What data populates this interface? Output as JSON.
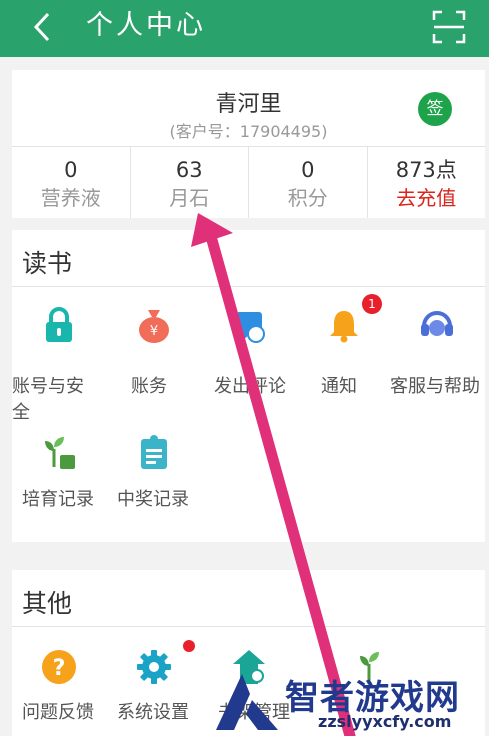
{
  "header": {
    "title": "个人中心",
    "back_icon": "chevron-left-icon",
    "scan_icon": "scan-icon"
  },
  "profile": {
    "name": "青河里",
    "customer_id": "(客户号：17904495)",
    "sign_label": "签",
    "stats": [
      {
        "value": "0",
        "label": "营养液"
      },
      {
        "value": "63",
        "label": "月石"
      },
      {
        "value": "0",
        "label": "积分"
      },
      {
        "value": "873点",
        "label": "去充值"
      }
    ]
  },
  "reading": {
    "title": "读书",
    "items": [
      {
        "label": "账号与安全",
        "icon": "lock-icon"
      },
      {
        "label": "账务",
        "icon": "money-bag-icon"
      },
      {
        "label": "发出评论",
        "icon": "comment-icon"
      },
      {
        "label": "通知",
        "icon": "bell-icon",
        "badge": "1"
      },
      {
        "label": "客服与帮助",
        "icon": "headset-icon"
      },
      {
        "label": "培育记录",
        "icon": "sprout-icon"
      },
      {
        "label": "中奖记录",
        "icon": "clipboard-icon"
      }
    ]
  },
  "other": {
    "title": "其他",
    "items": [
      {
        "label": "问题反馈",
        "icon": "question-icon"
      },
      {
        "label": "系统设置",
        "icon": "gear-icon"
      },
      {
        "label": "书架管理",
        "icon": "shelf-icon"
      },
      {
        "label": "",
        "icon": "sprout-icon"
      }
    ]
  },
  "watermark": {
    "text": "智者游戏网",
    "url": "zzslyyxcfy.com"
  },
  "colors": {
    "primary": "#2aa26b",
    "accent_red": "#d9251c",
    "arrow": "#e0307a"
  }
}
